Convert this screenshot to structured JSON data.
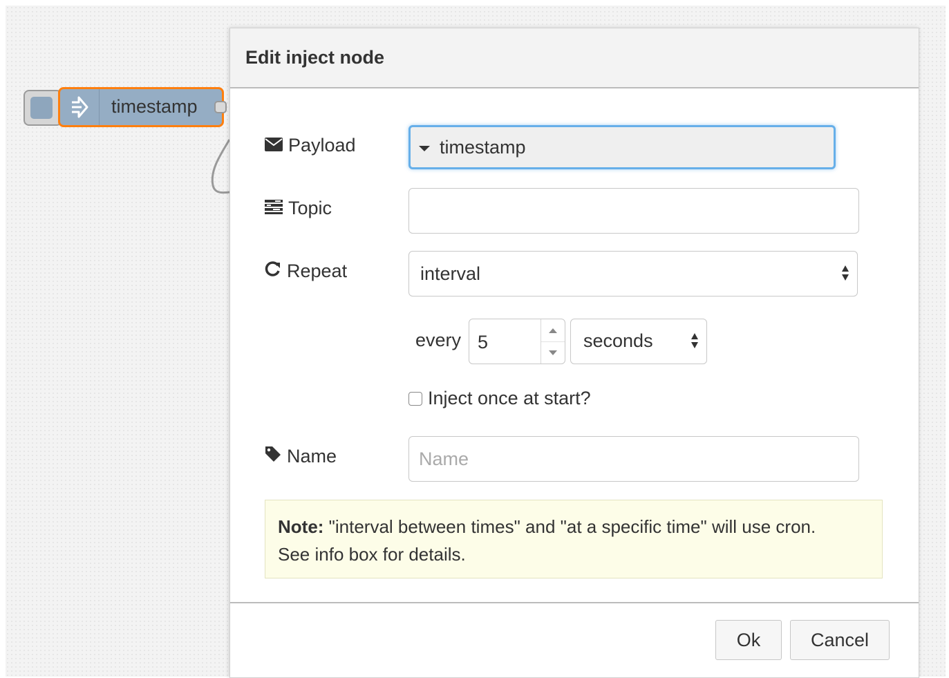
{
  "flow_node": {
    "label": "timestamp",
    "color": "#95adc4",
    "selected_outline_color": "#ff7f0e"
  },
  "dialog": {
    "title": "Edit inject node",
    "payload": {
      "label": "Payload",
      "icon": "envelope-icon",
      "value": "timestamp"
    },
    "topic": {
      "label": "Topic",
      "icon": "tasks-icon",
      "value": ""
    },
    "repeat": {
      "label": "Repeat",
      "icon": "repeat-icon",
      "value": "interval"
    },
    "interval": {
      "prefix": "every",
      "value": "5",
      "units": "seconds"
    },
    "inject_once": {
      "label": "Inject once at start?",
      "checked": false
    },
    "name": {
      "label": "Name",
      "icon": "tag-icon",
      "value": "",
      "placeholder": "Name"
    },
    "note": {
      "bold": "Note:",
      "text": " \"interval between times\" and \"at a specific time\" will use cron.",
      "line2": "See info box for details."
    },
    "buttons": {
      "ok": "Ok",
      "cancel": "Cancel"
    }
  },
  "colors": {
    "focus_border": "#66afe9",
    "note_bg": "#fdfde8",
    "header_bg": "#f3f3f3"
  }
}
